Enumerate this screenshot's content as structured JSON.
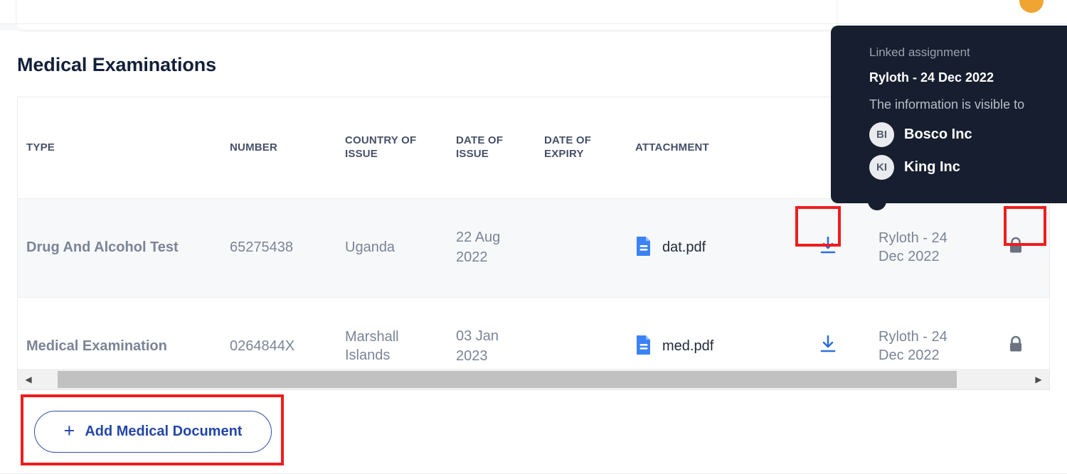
{
  "section": {
    "title": "Medical Examinations"
  },
  "table": {
    "columns": [
      {
        "id": "type",
        "label": "TYPE"
      },
      {
        "id": "number",
        "label": "NUMBER"
      },
      {
        "id": "country",
        "label": "COUNTRY OF ISSUE"
      },
      {
        "id": "date_issue",
        "label": "DATE OF ISSUE"
      },
      {
        "id": "date_expiry",
        "label": "DATE OF EXPIRY"
      },
      {
        "id": "attachment",
        "label": "ATTACHMENT"
      },
      {
        "id": "download",
        "label": ""
      },
      {
        "id": "linked",
        "label": ""
      },
      {
        "id": "lock",
        "label": ""
      }
    ],
    "rows": [
      {
        "type": "Drug And Alcohol Test",
        "number": "65275438",
        "country": "Uganda",
        "date_issue": "22 Aug 2022",
        "date_expiry": "",
        "attachment": "dat.pdf",
        "attachment_icon": "pdf-file-icon",
        "download_icon": "download-icon",
        "linked": "Ryloth - 24 Dec 2022",
        "lock_icon": "lock-icon"
      },
      {
        "type": "Medical Examination",
        "number": "0264844X",
        "country": "Marshall Islands",
        "date_issue": "03 Jan 2023",
        "date_expiry": "",
        "attachment": "med.pdf",
        "attachment_icon": "pdf-file-icon",
        "download_icon": "download-icon",
        "linked": "Ryloth - 24 Dec 2022",
        "lock_icon": "lock-icon"
      }
    ]
  },
  "scrollbar": {
    "left_arrow": "◀",
    "right_arrow": "▶"
  },
  "add_button": {
    "plus": "+",
    "label": "Add Medical Document",
    "icon": "plus-icon"
  },
  "tooltip": {
    "label": "Linked assignment",
    "assignment": "Ryloth - 24 Dec 2022",
    "visibility_label": "The information is visible to",
    "companies": [
      {
        "initials": "BI",
        "name": "Bosco Inc"
      },
      {
        "initials": "KI",
        "name": "King Inc"
      }
    ]
  },
  "colors": {
    "accent_blue": "#2346a6",
    "link_blue": "#3b82f6",
    "highlight_red": "#ef1d1d",
    "tooltip_bg": "#161e2f",
    "row_alt_bg": "#f7f8fa",
    "lock_gray": "#6b7280",
    "muted_text": "#7b8496",
    "heading_text": "#13203a"
  }
}
